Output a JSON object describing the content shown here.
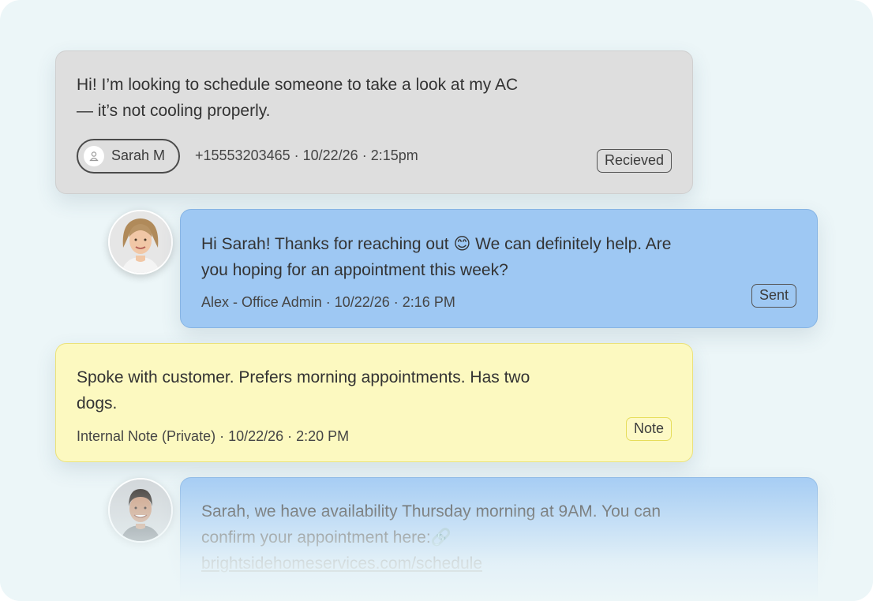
{
  "messages": [
    {
      "type": "received",
      "text_line1": "Hi! I’m looking to schedule someone to take a look at my AC",
      "text_line2": "— it’s not cooling properly.",
      "contact_name": "Sarah M",
      "meta": "+15553203465 · 10/22/26 · 2:15pm",
      "badge": "Recieved",
      "color": "#dedede"
    },
    {
      "type": "sent",
      "text_line1": "Hi Sarah! Thanks for reaching out 😊 We can definitely help. Are",
      "text_line2": "you hoping for an appointment this week?",
      "meta": "Alex - Office Admin · 10/22/26 · 2:16 PM",
      "badge": "Sent",
      "avatar": "woman-avatar",
      "color": "#9ec8f3"
    },
    {
      "type": "note",
      "text_line1": "Spoke with customer. Prefers morning appointments. Has two",
      "text_line2": "dogs.",
      "meta": "Internal Note (Private)  · 10/22/26 · 2:20 PM",
      "badge": "Note",
      "color": "#fcf9c0"
    },
    {
      "type": "sent",
      "text_line1": "Sarah, we have availability Thursday morning at 9AM. You can",
      "text_line2": "confirm your appointment here:🔗",
      "link": "brightsidehomeservices.com/schedule",
      "avatar": "man-avatar",
      "color": "#9ec8f3"
    }
  ]
}
